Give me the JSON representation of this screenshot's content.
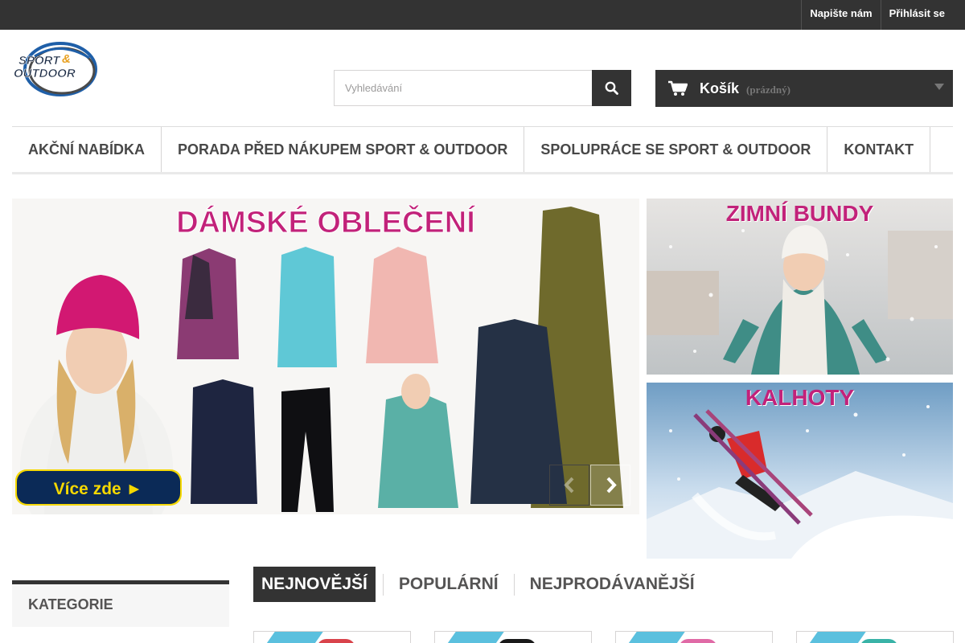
{
  "topbar": {
    "contact_label": "Napište nám",
    "login_label": "Přihlásit se"
  },
  "logo": {
    "line1": "SPORT &",
    "line2": "OUTDOOR"
  },
  "search": {
    "placeholder": "Vyhledávání"
  },
  "cart": {
    "label": "Košík",
    "status": "(prázdný)"
  },
  "menu": {
    "items": [
      {
        "label": "AKČNÍ NABÍDKA"
      },
      {
        "label": "PORADA PŘED NÁKUPEM SPORT & OUTDOOR"
      },
      {
        "label": "SPOLUPRÁCE SE SPORT & OUTDOOR"
      },
      {
        "label": "KONTAKT"
      }
    ]
  },
  "slider": {
    "title": "DÁMSKÉ OBLEČENÍ",
    "cta": "Více zde ►"
  },
  "banners": [
    {
      "title": "ZIMNÍ BUNDY"
    },
    {
      "title": "KALHOTY"
    }
  ],
  "sidebar": {
    "categories_title": "KATEGORIE"
  },
  "tabs": [
    {
      "label": "NEJNOVĚJŠÍ"
    },
    {
      "label": "POPULÁRNÍ"
    },
    {
      "label": "NEJPRODÁVANĚJŠÍ"
    }
  ],
  "colors": {
    "dark": "#333333",
    "accent_pink": "#c2227a",
    "ribbon_blue": "#5bc0de",
    "button_navy": "#0b2a57",
    "button_yellow": "#f5d800"
  }
}
